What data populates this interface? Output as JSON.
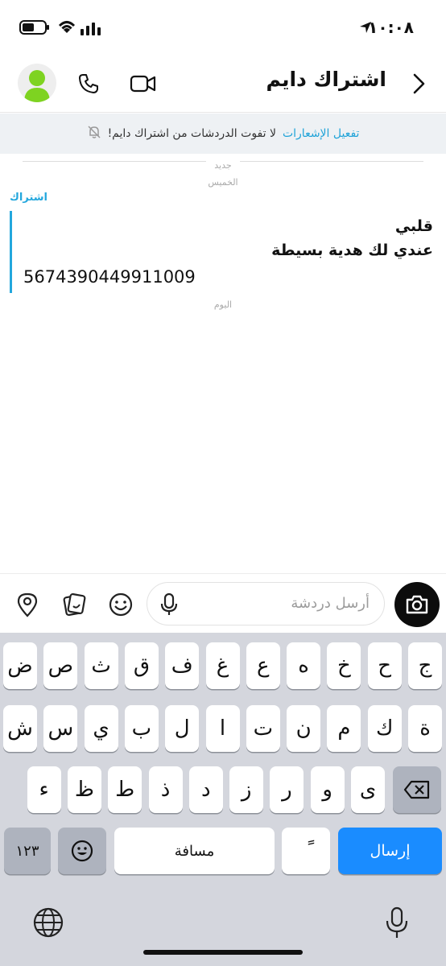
{
  "status_bar": {
    "time": "١٠:٠٨"
  },
  "header": {
    "title": "اشتراك دايم"
  },
  "banner": {
    "link": "تفعيل الإشعارات",
    "text": "لا تفوت الدردشات من اشتراك دايم!"
  },
  "chat": {
    "new_label": "جديد",
    "day1": "الخميس",
    "sender": "اشتراك",
    "message_lines": [
      "قلبي",
      "عندي لك هدية بسيطة"
    ],
    "message_number": "5674390449911009",
    "day2": "اليوم"
  },
  "composer": {
    "placeholder": "أرسل دردشة"
  },
  "keyboard": {
    "row1": [
      "ج",
      "ح",
      "خ",
      "ه",
      "ع",
      "غ",
      "ف",
      "ق",
      "ث",
      "ص",
      "ض"
    ],
    "row2": [
      "ة",
      "ك",
      "م",
      "ن",
      "ت",
      "ا",
      "ل",
      "ب",
      "ي",
      "س",
      "ش"
    ],
    "row3": [
      "ى",
      "و",
      "ر",
      "ز",
      "د",
      "ذ",
      "ط",
      "ظ",
      "ء"
    ],
    "numbers": "١٢٣",
    "space": "مسافة",
    "diacritic": "ً",
    "send": "إرسال"
  },
  "colors": {
    "accent": "#23a7dd",
    "send_key": "#1a8cff",
    "avatar": "#7ed321"
  }
}
